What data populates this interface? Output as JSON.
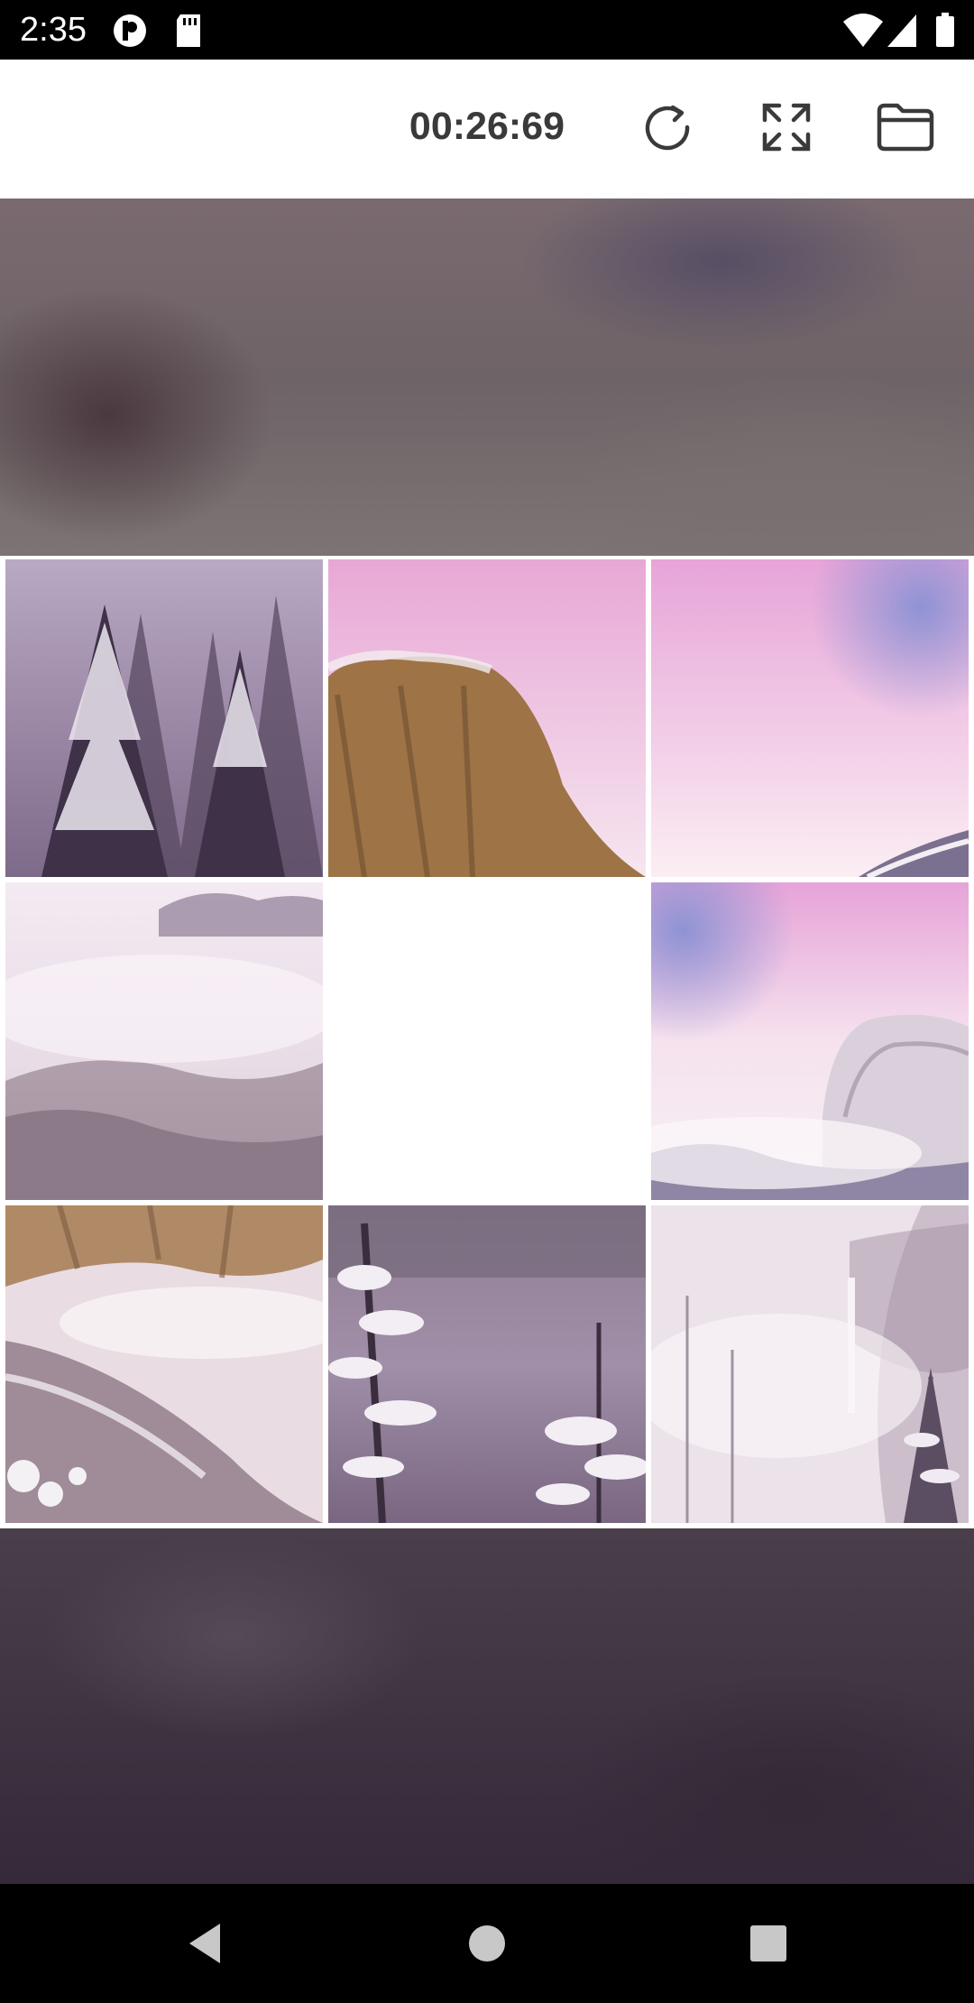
{
  "status_bar": {
    "time": "2:35",
    "icons": [
      "app-notification-icon",
      "sd-card-icon",
      "wifi-icon",
      "signal-icon",
      "battery-icon"
    ]
  },
  "toolbar": {
    "timer": "00:26:69",
    "icons": [
      "refresh-icon",
      "fullscreen-icon",
      "folder-icon"
    ]
  },
  "puzzle": {
    "grid": "3x3",
    "empty_position": {
      "row": 2,
      "col": 2
    },
    "tiles": [
      {
        "row": 1,
        "col": 1,
        "description": "snowy-pine-forest"
      },
      {
        "row": 1,
        "col": 2,
        "description": "granite-cliff"
      },
      {
        "row": 1,
        "col": 3,
        "description": "pink-sky"
      },
      {
        "row": 2,
        "col": 1,
        "description": "misty-valley"
      },
      {
        "row": 2,
        "col": 3,
        "description": "snowy-dome-in-clouds"
      },
      {
        "row": 3,
        "col": 1,
        "description": "snowy-slope-with-cliff"
      },
      {
        "row": 3,
        "col": 2,
        "description": "snowy-branches"
      },
      {
        "row": 3,
        "col": 3,
        "description": "misty-waterfall"
      }
    ]
  },
  "nav_bar": {
    "icons": [
      "back-icon",
      "home-icon",
      "recents-icon"
    ]
  }
}
